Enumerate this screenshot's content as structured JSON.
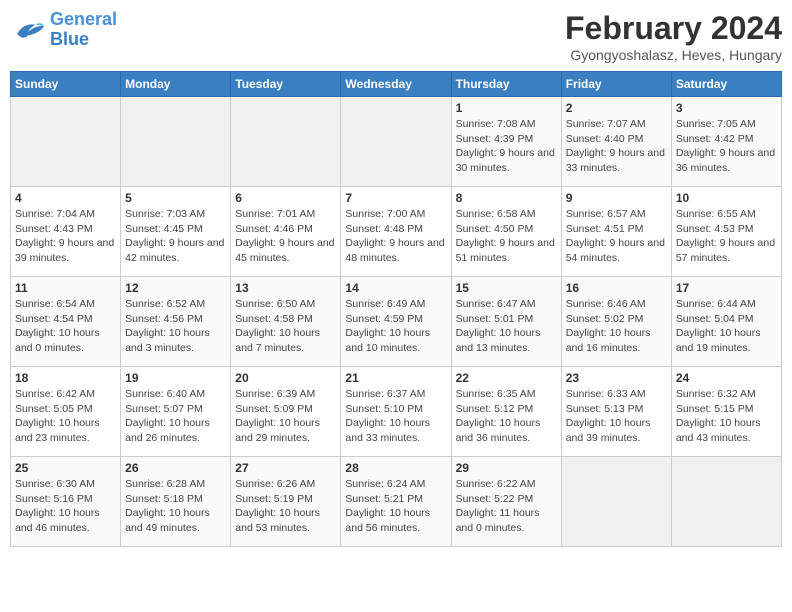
{
  "logo": {
    "line1": "General",
    "line2": "Blue"
  },
  "title": "February 2024",
  "subtitle": "Gyongyoshalasz, Heves, Hungary",
  "days_of_week": [
    "Sunday",
    "Monday",
    "Tuesday",
    "Wednesday",
    "Thursday",
    "Friday",
    "Saturday"
  ],
  "weeks": [
    [
      {
        "day": "",
        "info": ""
      },
      {
        "day": "",
        "info": ""
      },
      {
        "day": "",
        "info": ""
      },
      {
        "day": "",
        "info": ""
      },
      {
        "day": "1",
        "info": "Sunrise: 7:08 AM\nSunset: 4:39 PM\nDaylight: 9 hours and 30 minutes."
      },
      {
        "day": "2",
        "info": "Sunrise: 7:07 AM\nSunset: 4:40 PM\nDaylight: 9 hours and 33 minutes."
      },
      {
        "day": "3",
        "info": "Sunrise: 7:05 AM\nSunset: 4:42 PM\nDaylight: 9 hours and 36 minutes."
      }
    ],
    [
      {
        "day": "4",
        "info": "Sunrise: 7:04 AM\nSunset: 4:43 PM\nDaylight: 9 hours and 39 minutes."
      },
      {
        "day": "5",
        "info": "Sunrise: 7:03 AM\nSunset: 4:45 PM\nDaylight: 9 hours and 42 minutes."
      },
      {
        "day": "6",
        "info": "Sunrise: 7:01 AM\nSunset: 4:46 PM\nDaylight: 9 hours and 45 minutes."
      },
      {
        "day": "7",
        "info": "Sunrise: 7:00 AM\nSunset: 4:48 PM\nDaylight: 9 hours and 48 minutes."
      },
      {
        "day": "8",
        "info": "Sunrise: 6:58 AM\nSunset: 4:50 PM\nDaylight: 9 hours and 51 minutes."
      },
      {
        "day": "9",
        "info": "Sunrise: 6:57 AM\nSunset: 4:51 PM\nDaylight: 9 hours and 54 minutes."
      },
      {
        "day": "10",
        "info": "Sunrise: 6:55 AM\nSunset: 4:53 PM\nDaylight: 9 hours and 57 minutes."
      }
    ],
    [
      {
        "day": "11",
        "info": "Sunrise: 6:54 AM\nSunset: 4:54 PM\nDaylight: 10 hours and 0 minutes."
      },
      {
        "day": "12",
        "info": "Sunrise: 6:52 AM\nSunset: 4:56 PM\nDaylight: 10 hours and 3 minutes."
      },
      {
        "day": "13",
        "info": "Sunrise: 6:50 AM\nSunset: 4:58 PM\nDaylight: 10 hours and 7 minutes."
      },
      {
        "day": "14",
        "info": "Sunrise: 6:49 AM\nSunset: 4:59 PM\nDaylight: 10 hours and 10 minutes."
      },
      {
        "day": "15",
        "info": "Sunrise: 6:47 AM\nSunset: 5:01 PM\nDaylight: 10 hours and 13 minutes."
      },
      {
        "day": "16",
        "info": "Sunrise: 6:46 AM\nSunset: 5:02 PM\nDaylight: 10 hours and 16 minutes."
      },
      {
        "day": "17",
        "info": "Sunrise: 6:44 AM\nSunset: 5:04 PM\nDaylight: 10 hours and 19 minutes."
      }
    ],
    [
      {
        "day": "18",
        "info": "Sunrise: 6:42 AM\nSunset: 5:05 PM\nDaylight: 10 hours and 23 minutes."
      },
      {
        "day": "19",
        "info": "Sunrise: 6:40 AM\nSunset: 5:07 PM\nDaylight: 10 hours and 26 minutes."
      },
      {
        "day": "20",
        "info": "Sunrise: 6:39 AM\nSunset: 5:09 PM\nDaylight: 10 hours and 29 minutes."
      },
      {
        "day": "21",
        "info": "Sunrise: 6:37 AM\nSunset: 5:10 PM\nDaylight: 10 hours and 33 minutes."
      },
      {
        "day": "22",
        "info": "Sunrise: 6:35 AM\nSunset: 5:12 PM\nDaylight: 10 hours and 36 minutes."
      },
      {
        "day": "23",
        "info": "Sunrise: 6:33 AM\nSunset: 5:13 PM\nDaylight: 10 hours and 39 minutes."
      },
      {
        "day": "24",
        "info": "Sunrise: 6:32 AM\nSunset: 5:15 PM\nDaylight: 10 hours and 43 minutes."
      }
    ],
    [
      {
        "day": "25",
        "info": "Sunrise: 6:30 AM\nSunset: 5:16 PM\nDaylight: 10 hours and 46 minutes."
      },
      {
        "day": "26",
        "info": "Sunrise: 6:28 AM\nSunset: 5:18 PM\nDaylight: 10 hours and 49 minutes."
      },
      {
        "day": "27",
        "info": "Sunrise: 6:26 AM\nSunset: 5:19 PM\nDaylight: 10 hours and 53 minutes."
      },
      {
        "day": "28",
        "info": "Sunrise: 6:24 AM\nSunset: 5:21 PM\nDaylight: 10 hours and 56 minutes."
      },
      {
        "day": "29",
        "info": "Sunrise: 6:22 AM\nSunset: 5:22 PM\nDaylight: 11 hours and 0 minutes."
      },
      {
        "day": "",
        "info": ""
      },
      {
        "day": "",
        "info": ""
      }
    ]
  ]
}
